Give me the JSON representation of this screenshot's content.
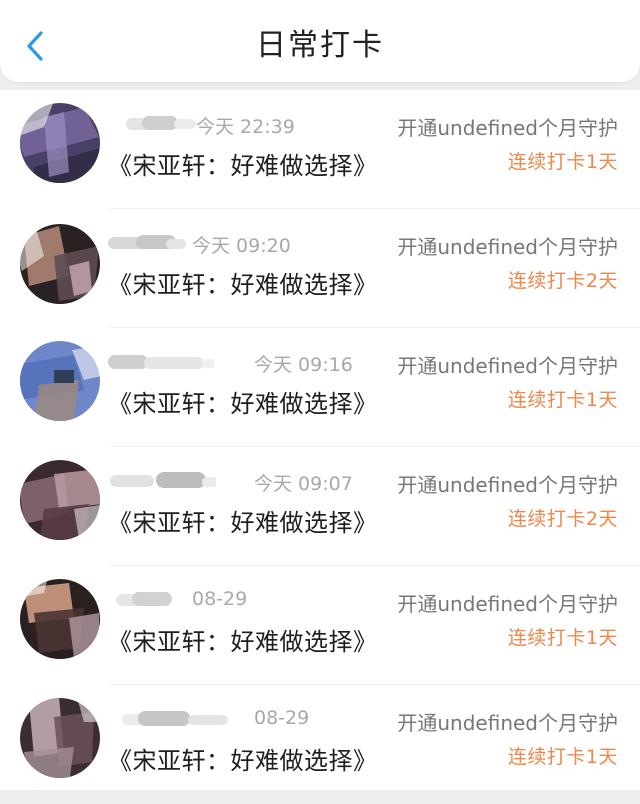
{
  "header": {
    "title": "日常打卡",
    "back_icon": "chevron-left-icon",
    "accent_color": "#2b9ae6"
  },
  "checkins": [
    {
      "time": "今天 22:39",
      "guard": "开通undefined个月守护",
      "song": "《宋亚轩：好难做选择》",
      "streak": "连续打卡1天"
    },
    {
      "time": "今天 09:20",
      "guard": "开通undefined个月守护",
      "song": "《宋亚轩：好难做选择》",
      "streak": "连续打卡2天"
    },
    {
      "time": "今天 09:16",
      "guard": "开通undefined个月守护",
      "song": "《宋亚轩：好难做选择》",
      "streak": "连续打卡1天"
    },
    {
      "time": "今天 09:07",
      "guard": "开通undefined个月守护",
      "song": "《宋亚轩：好难做选择》",
      "streak": "连续打卡2天"
    },
    {
      "time": "08-29",
      "guard": "开通undefined个月守护",
      "song": "《宋亚轩：好难做选择》",
      "streak": "连续打卡1天"
    },
    {
      "time": "08-29",
      "guard": "开通undefined个月守护",
      "song": "《宋亚轩：好难做选择》",
      "streak": "连续打卡1天"
    }
  ],
  "colors": {
    "streak": "#f0874a",
    "time": "#a8a8a8",
    "guard": "#777777"
  }
}
